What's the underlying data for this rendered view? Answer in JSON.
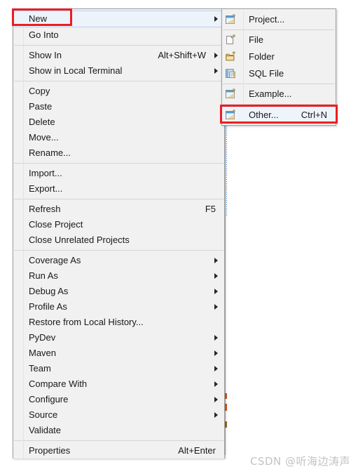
{
  "context_menu": {
    "groups": [
      {
        "items": [
          {
            "label": "New",
            "accel": "",
            "submenu": true,
            "selected": true
          },
          {
            "label": "Go Into",
            "accel": "",
            "submenu": false,
            "selected": false
          }
        ]
      },
      {
        "items": [
          {
            "label": "Show In",
            "accel": "Alt+Shift+W",
            "submenu": true,
            "selected": false
          },
          {
            "label": "Show in Local Terminal",
            "accel": "",
            "submenu": true,
            "selected": false
          }
        ]
      },
      {
        "items": [
          {
            "label": "Copy",
            "accel": "",
            "submenu": false,
            "selected": false
          },
          {
            "label": "Paste",
            "accel": "",
            "submenu": false,
            "selected": false
          },
          {
            "label": "Delete",
            "accel": "",
            "submenu": false,
            "selected": false
          },
          {
            "label": "Move...",
            "accel": "",
            "submenu": false,
            "selected": false
          },
          {
            "label": "Rename...",
            "accel": "",
            "submenu": false,
            "selected": false
          }
        ]
      },
      {
        "items": [
          {
            "label": "Import...",
            "accel": "",
            "submenu": false,
            "selected": false
          },
          {
            "label": "Export...",
            "accel": "",
            "submenu": false,
            "selected": false
          }
        ]
      },
      {
        "items": [
          {
            "label": "Refresh",
            "accel": "F5",
            "submenu": false,
            "selected": false
          },
          {
            "label": "Close Project",
            "accel": "",
            "submenu": false,
            "selected": false
          },
          {
            "label": "Close Unrelated Projects",
            "accel": "",
            "submenu": false,
            "selected": false
          }
        ]
      },
      {
        "items": [
          {
            "label": "Coverage As",
            "accel": "",
            "submenu": true,
            "selected": false
          },
          {
            "label": "Run As",
            "accel": "",
            "submenu": true,
            "selected": false
          },
          {
            "label": "Debug As",
            "accel": "",
            "submenu": true,
            "selected": false
          },
          {
            "label": "Profile As",
            "accel": "",
            "submenu": true,
            "selected": false
          },
          {
            "label": "Restore from Local History...",
            "accel": "",
            "submenu": false,
            "selected": false
          },
          {
            "label": "PyDev",
            "accel": "",
            "submenu": true,
            "selected": false
          },
          {
            "label": "Maven",
            "accel": "",
            "submenu": true,
            "selected": false
          },
          {
            "label": "Team",
            "accel": "",
            "submenu": true,
            "selected": false
          },
          {
            "label": "Compare With",
            "accel": "",
            "submenu": true,
            "selected": false
          },
          {
            "label": "Configure",
            "accel": "",
            "submenu": true,
            "selected": false
          },
          {
            "label": "Source",
            "accel": "",
            "submenu": true,
            "selected": false
          },
          {
            "label": "Validate",
            "accel": "",
            "submenu": false,
            "selected": false
          }
        ]
      },
      {
        "items": [
          {
            "label": "Properties",
            "accel": "Alt+Enter",
            "submenu": false,
            "selected": false
          }
        ]
      }
    ]
  },
  "new_submenu": {
    "groups": [
      {
        "items": [
          {
            "label": "Project...",
            "accel": "",
            "icon": "new-project-icon",
            "highlighted": false
          }
        ]
      },
      {
        "items": [
          {
            "label": "File",
            "accel": "",
            "icon": "new-file-icon",
            "highlighted": false
          },
          {
            "label": "Folder",
            "accel": "",
            "icon": "new-folder-icon",
            "highlighted": false
          },
          {
            "label": "SQL File",
            "accel": "",
            "icon": "new-sql-file-icon",
            "highlighted": false
          }
        ]
      },
      {
        "items": [
          {
            "label": "Example...",
            "accel": "",
            "icon": "new-example-icon",
            "highlighted": false
          }
        ]
      },
      {
        "items": [
          {
            "label": "Other...",
            "accel": "Ctrl+N",
            "icon": "new-other-icon",
            "highlighted": true
          }
        ]
      }
    ]
  },
  "annotations": {
    "boxes": [
      {
        "name": "new-highlight-box",
        "color": "#ee1c22"
      },
      {
        "name": "other-highlight-box",
        "color": "#ee1c22"
      }
    ]
  },
  "watermark": {
    "text": "CSDN @听海边涛声"
  },
  "colors": {
    "menu_background": "#f1f1f1",
    "menu_border": "#a0a0a0",
    "separator": "#d4d4d4",
    "text": "#181818",
    "selection_fill": "#edf3fb",
    "selection_border": "#b8d2ee",
    "annotation_red": "#ee1c22",
    "watermark_gray": "#c3c3c3",
    "focus_dots_blue": "#3b7fd4"
  }
}
